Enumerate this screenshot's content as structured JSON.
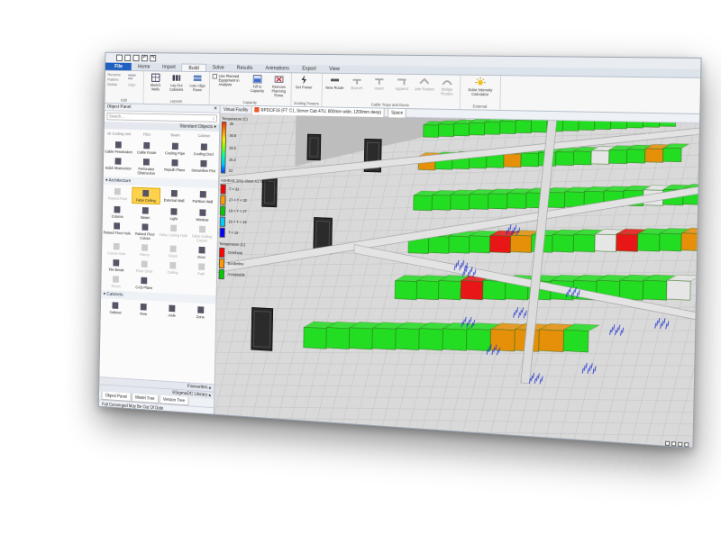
{
  "qat": {
    "buttons": [
      "↶",
      "↷"
    ]
  },
  "tabs": [
    "File",
    "Home",
    "Import",
    "Build",
    "Solve",
    "Results",
    "Animations",
    "Export",
    "View"
  ],
  "ribbon": {
    "edit": {
      "label": "Edit",
      "items": [
        "Rename",
        "Pattern",
        "Delete"
      ],
      "align": "Align"
    },
    "layouts": {
      "label": "Layouts",
      "buttons": [
        "Sketch Walls",
        "Lay Out Cabinets",
        "Auto Align Rows"
      ]
    },
    "capacity": {
      "label": "Capacity",
      "checkbox": "Use Planned Equipment in Analysis",
      "buttons": [
        "Fill to Capacity",
        "Remove Planning Rows"
      ]
    },
    "scaling": {
      "label": "Scaling Powers",
      "buttons": [
        "Set Power"
      ]
    },
    "cables": {
      "label": "Cable Trays and Ducts",
      "buttons": [
        "New Route",
        "Branch",
        "Insert",
        "Append",
        "Join Routes",
        "Bridge Routes"
      ]
    },
    "external": {
      "label": "External",
      "buttons": [
        "Solar Intensity Calculator"
      ]
    }
  },
  "panel": {
    "title": "Object Panel",
    "search_placeholder": "Search...",
    "standard_objects": "Standard Objects",
    "top_row": [
      "Air Cooling Unit",
      "PDU",
      "Beam",
      "Cabinet"
    ],
    "group1": [
      "Cable Penetration",
      "Cable Route",
      "Cooling Pipe",
      "Cooling Duct",
      "Solid Obstruction",
      "Perforated Obstruction",
      "Repulh Plane",
      "Streamline Plot"
    ],
    "architecture_label": "Architecture",
    "architecture": [
      "Raised Floor",
      "False Ceiling",
      "External Wall",
      "Partition Wall",
      "Column",
      "Beam",
      "Light",
      "Window",
      "Raised Floor Hole",
      "Raised Floor Cutout",
      "False Ceiling Hole",
      "False Ceiling Cutout",
      "Cutout Hole",
      "Ramp",
      "Slope",
      "Door",
      "Tile Break",
      "Floor Deck",
      "Ceiling",
      "Path",
      "Room",
      "CAD Plane"
    ],
    "cabinets_label": "Cabinets",
    "cabinets": [
      "Cabinet",
      "Row",
      "Aisle",
      "Zone"
    ],
    "favourites": "Favourites",
    "library": "6SigmaDC Library",
    "bottom_tabs": [
      "Object Panel",
      "Model Tree",
      "Version Tree"
    ],
    "status": "Full Converged May Be Out Of Date"
  },
  "viewport": {
    "tab1": "Virtual Facility",
    "tab2": "RPDC/F16 (FT: C1, Server Cab 47U, 800mm wide, 1200mm deep)",
    "tab3": "Space",
    "legend": {
      "title1": "Temperature (C)",
      "ticks": [
        "35",
        "30.8",
        "28.5",
        "25.3",
        "22"
      ],
      "title2": "ASHRAE 2011 Class A1 Temp. (C)",
      "classes": [
        "T > 32",
        "27 < T < 32",
        "18 < T < 27",
        "15 < T < 18",
        "T < 15"
      ],
      "title3": "Temperature (C)",
      "status": [
        "Overheat",
        "Borderline",
        "Acceptable"
      ],
      "class_colors": [
        "#ff0000",
        "#ff9900",
        "#00cc00",
        "#00ccff",
        "#0000ff"
      ],
      "status_colors": [
        "#ff0000",
        "#ff9900",
        "#00cc00"
      ]
    }
  },
  "colors": {
    "accent": "#1f5fbf",
    "ok": "#22dd22",
    "warn": "#e6900a",
    "hot": "#e81616",
    "idle": "#e6e6e6"
  }
}
